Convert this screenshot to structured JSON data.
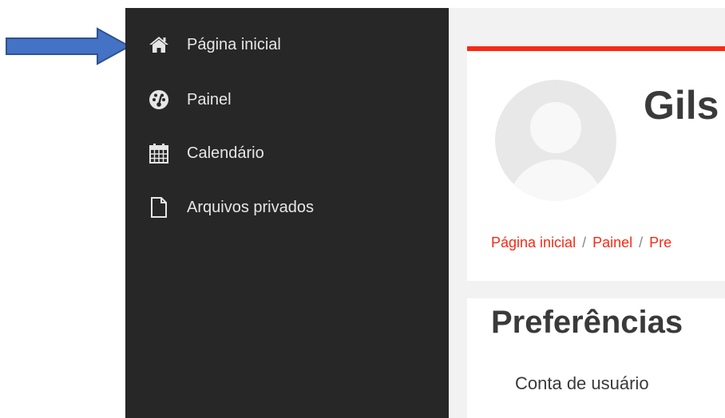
{
  "sidebar": {
    "items": [
      {
        "label": "Página inicial",
        "icon": "home-icon"
      },
      {
        "label": "Painel",
        "icon": "dashboard-icon"
      },
      {
        "label": "Calendário",
        "icon": "calendar-icon"
      },
      {
        "label": "Arquivos privados",
        "icon": "file-icon"
      }
    ]
  },
  "header": {
    "user_name": "Gils",
    "breadcrumb": [
      "Página inicial",
      "Painel",
      "Pre"
    ],
    "breadcrumb_separator": "/"
  },
  "main": {
    "title": "Preferências",
    "section_label": "Conta de usuário"
  },
  "colors": {
    "sidebar_bg": "#272727",
    "accent": "#f52a15",
    "annotation_arrow": "#4472c4"
  }
}
